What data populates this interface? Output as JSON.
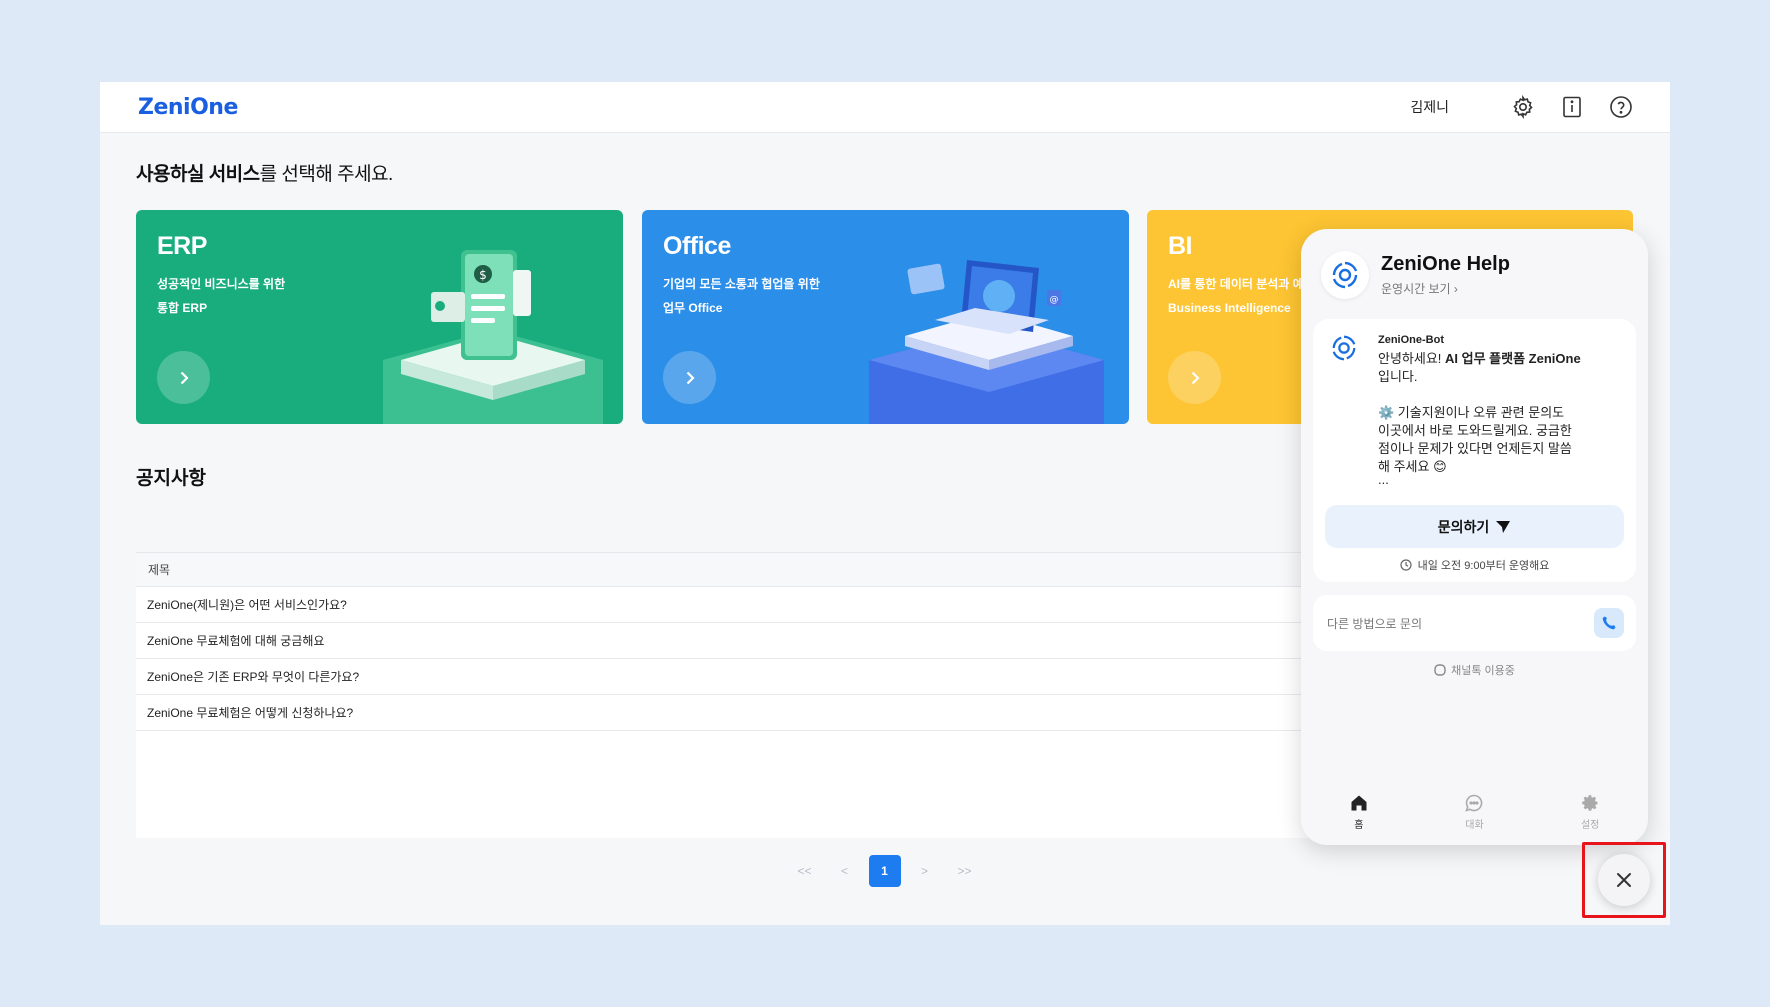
{
  "header": {
    "logo": "ZeniOne",
    "username": "김제니",
    "icons": [
      "gear-icon",
      "info-icon",
      "help-icon"
    ]
  },
  "main": {
    "title_bold": "사용하실 서비스",
    "title_rest": "를 선택해 주세요.",
    "cards": [
      {
        "title": "ERP",
        "desc1": "성공적인 비즈니스를 위한",
        "desc2": "통합 ERP",
        "color": "#19ad7e"
      },
      {
        "title": "Office",
        "desc1": "기업의 모든 소통과 협업을 위한",
        "desc2": "업무 Office",
        "color": "#2b8ee8"
      },
      {
        "title": "BI",
        "desc1": "AI를 통한 데이터 분석과 예",
        "desc2": "Business Intelligence",
        "color": "#fdc533"
      }
    ]
  },
  "notice": {
    "title": "공지사항",
    "column": "제목",
    "rows": [
      "ZeniOne(제니원)은 어떤 서비스인가요?",
      "ZeniOne 무료체험에 대해 궁금해요",
      "ZeniOne은 기존 ERP와 무엇이 다른가요?",
      "ZeniOne 무료체험은 어떻게 신청하나요?"
    ]
  },
  "pagination": {
    "first": "<<",
    "prev": "<",
    "current": "1",
    "next": ">",
    "last": ">>"
  },
  "chat": {
    "title": "ZeniOne Help",
    "subtitle": "운영시간 보기 ›",
    "bot_name": "ZeniOne-Bot",
    "msg_line1_prefix": "안녕하세요! ",
    "msg_line1_bold": "AI 업무 플랫폼 ZeniOne",
    "msg_line1_suffix": "입니다.",
    "msg_line2": "⚙️ 기술지원이나 오류 관련 문의도\n이곳에서 바로 도와드릴게요. 궁금한\n점이나 문제가 있다면 언제든지 말씀\n해 주세요 😊",
    "msg_ellipsis": "...",
    "ask_label": "문의하기",
    "hours": "내일 오전 9:00부터 운영해요",
    "alt_contact": "다른 방법으로 문의",
    "channel": "채널톡 이용중",
    "nav": {
      "home": "홈",
      "chat": "대화",
      "settings": "설정"
    }
  },
  "accent": "#1e7cf1"
}
